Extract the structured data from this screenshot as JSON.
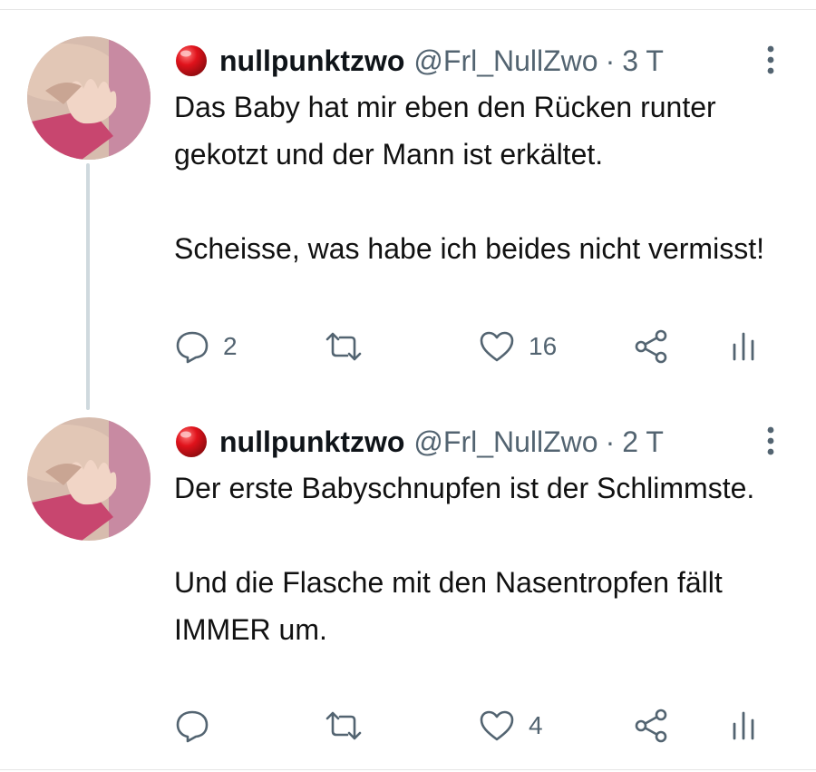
{
  "thread": [
    {
      "author": {
        "name": "nullpunktzwo",
        "handle": "@Frl_NullZwo",
        "emoji": "red-circle-icon"
      },
      "separator": "·",
      "time": "3 T",
      "paragraphs": [
        "Das Baby hat mir eben den Rücken runter gekotzt und der Mann ist erkältet.",
        "Scheisse, was habe ich beides nicht vermisst!"
      ],
      "actions": {
        "replies": "2",
        "retweets": "",
        "likes": "16"
      }
    },
    {
      "author": {
        "name": "nullpunktzwo",
        "handle": "@Frl_NullZwo",
        "emoji": "red-circle-icon"
      },
      "separator": "·",
      "time": "2 T",
      "paragraphs": [
        "Der erste Babyschnupfen ist der Schlimmste.",
        "Und die Flasche mit den Nasentropfen fällt IMMER um."
      ],
      "actions": {
        "replies": "",
        "retweets": "",
        "likes": "4"
      }
    }
  ],
  "colors": {
    "muted": "#536471",
    "thread_line": "#cfd9de",
    "emoji_red": "#e0121b"
  }
}
